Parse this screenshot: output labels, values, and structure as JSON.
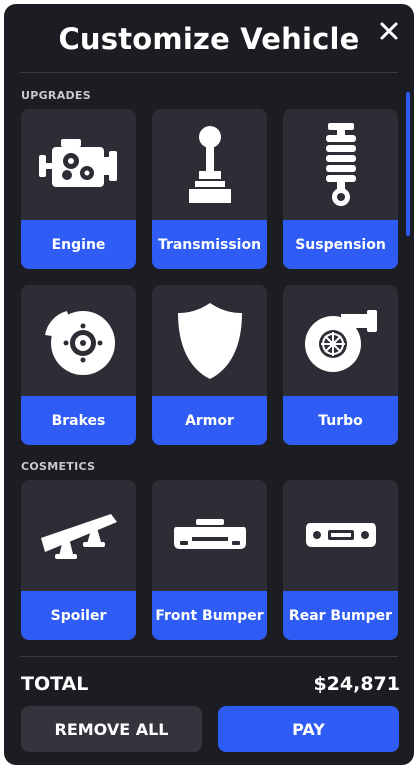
{
  "title": "Customize Vehicle",
  "sections": {
    "upgrades": "UPGRADES",
    "cosmetics": "COSMETICS"
  },
  "upgrades": [
    {
      "label": "Engine",
      "icon": "engine-icon"
    },
    {
      "label": "Transmission",
      "icon": "gear-shifter-icon"
    },
    {
      "label": "Suspension",
      "icon": "suspension-icon"
    },
    {
      "label": "Brakes",
      "icon": "brake-disc-icon"
    },
    {
      "label": "Armor",
      "icon": "shield-icon"
    },
    {
      "label": "Turbo",
      "icon": "turbo-icon"
    }
  ],
  "cosmetics": [
    {
      "label": "Spoiler",
      "icon": "spoiler-icon"
    },
    {
      "label": "Front Bumper",
      "icon": "front-bumper-icon"
    },
    {
      "label": "Rear Bumper",
      "icon": "rear-bumper-icon"
    }
  ],
  "footer": {
    "total_label": "TOTAL",
    "total_value": "$24,871",
    "remove_label": "REMOVE ALL",
    "pay_label": "PAY"
  },
  "colors": {
    "accent": "#2e5cf5",
    "panel": "#1c1d22",
    "card": "#2d2e35"
  }
}
